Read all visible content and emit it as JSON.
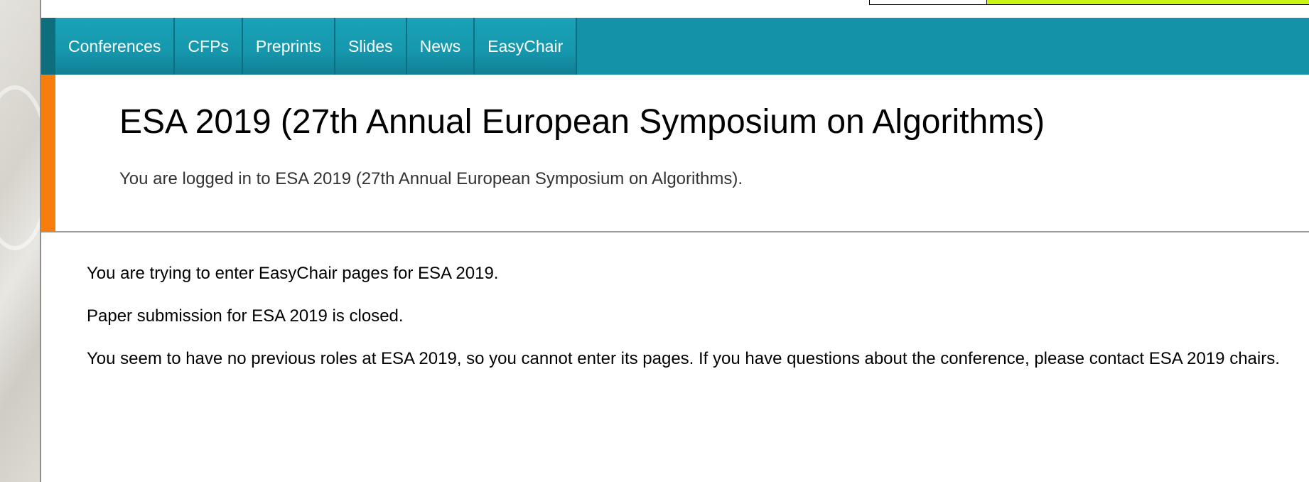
{
  "nav": {
    "items": [
      {
        "label": "Conferences"
      },
      {
        "label": "CFPs"
      },
      {
        "label": "Preprints"
      },
      {
        "label": "Slides"
      },
      {
        "label": "News"
      },
      {
        "label": "EasyChair"
      }
    ]
  },
  "header": {
    "title": "ESA 2019 (27th Annual European Symposium on Algorithms)",
    "login_message": "You are logged in to ESA 2019 (27th Annual European Symposium on Algorithms)."
  },
  "main": {
    "messages": [
      "You are trying to enter EasyChair pages for ESA 2019.",
      "Paper submission for ESA 2019 is closed.",
      "You seem to have no previous roles at ESA 2019, so you cannot enter its pages. If you have questions about the conference, please contact ESA 2019 chairs."
    ]
  },
  "colors": {
    "nav_bg": "#1492a8",
    "accent_orange": "#f77e0c",
    "top_lime": "#c8f514"
  }
}
